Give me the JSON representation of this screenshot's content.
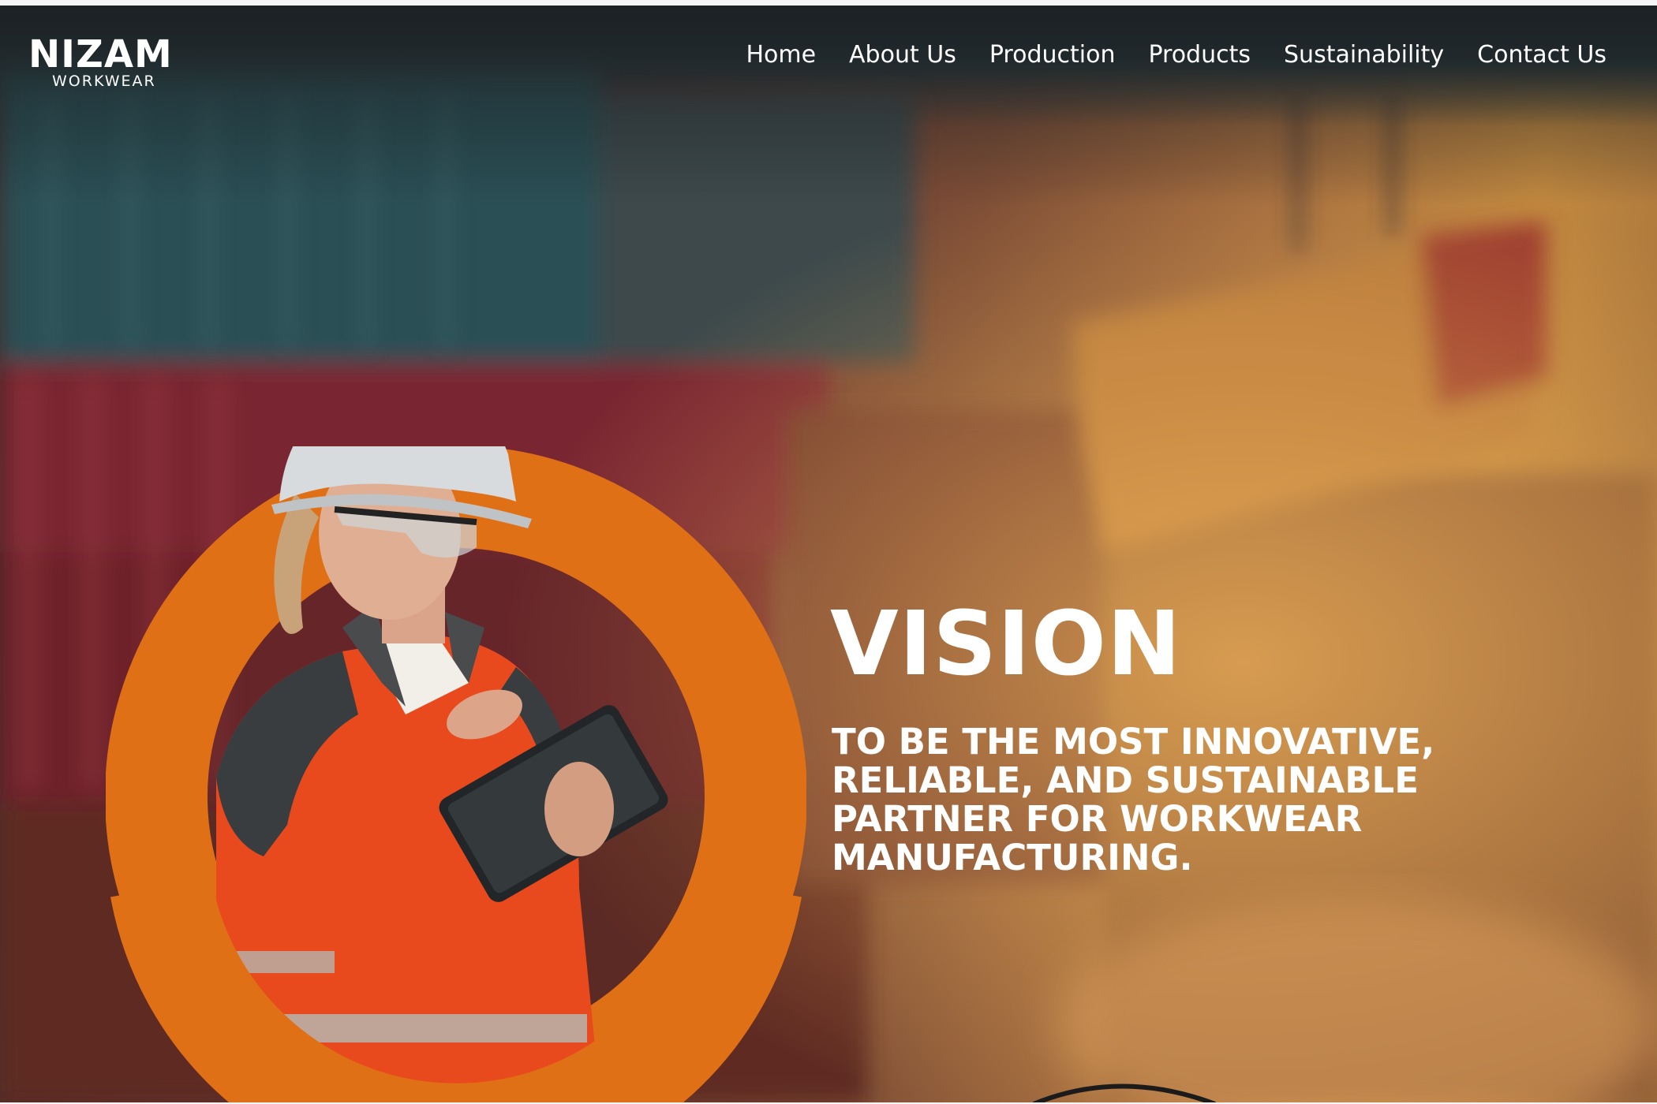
{
  "brand": {
    "name": "NIZAM",
    "tagline": "WORKWEAR",
    "accent_color": "#e07016"
  },
  "nav": {
    "items": [
      {
        "label": "Home"
      },
      {
        "label": "About Us"
      },
      {
        "label": "Production"
      },
      {
        "label": "Products"
      },
      {
        "label": "Sustainability"
      },
      {
        "label": "Contact Us"
      }
    ]
  },
  "hero": {
    "title": "VISION",
    "statement_lines": [
      "TO BE THE MOST INNOVATIVE,",
      "RELIABLE, AND SUSTAINABLE",
      "PARTNER FOR WORKWEAR",
      "MANUFACTURING."
    ],
    "image_subject": "worker-with-tablet-photo",
    "background_subject": "shipping-container-port-photo"
  }
}
